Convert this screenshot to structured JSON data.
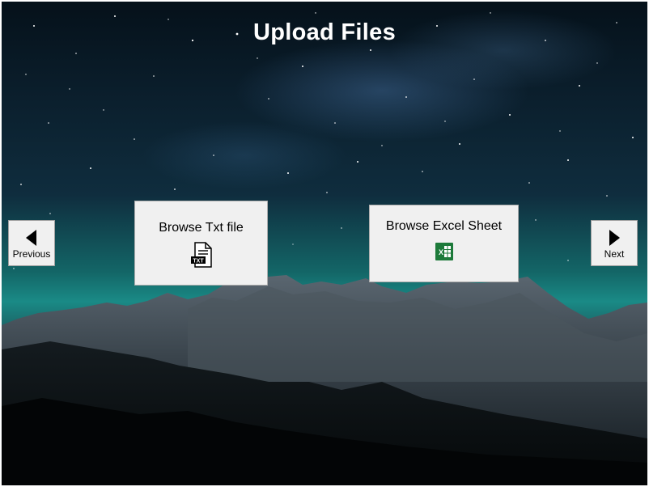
{
  "page": {
    "title": "Upload Files"
  },
  "buttons": {
    "browse_txt": {
      "label": "Browse Txt file",
      "icon": "txt-file-icon"
    },
    "browse_excel": {
      "label": "Browse Excel Sheet",
      "icon": "excel-icon"
    },
    "previous": {
      "label": "Previous",
      "icon": "triangle-left-icon"
    },
    "next": {
      "label": "Next",
      "icon": "triangle-right-icon"
    }
  },
  "colors": {
    "excel_green": "#1d7a3a",
    "button_face": "#f0f0f0",
    "title": "#ffffff"
  }
}
